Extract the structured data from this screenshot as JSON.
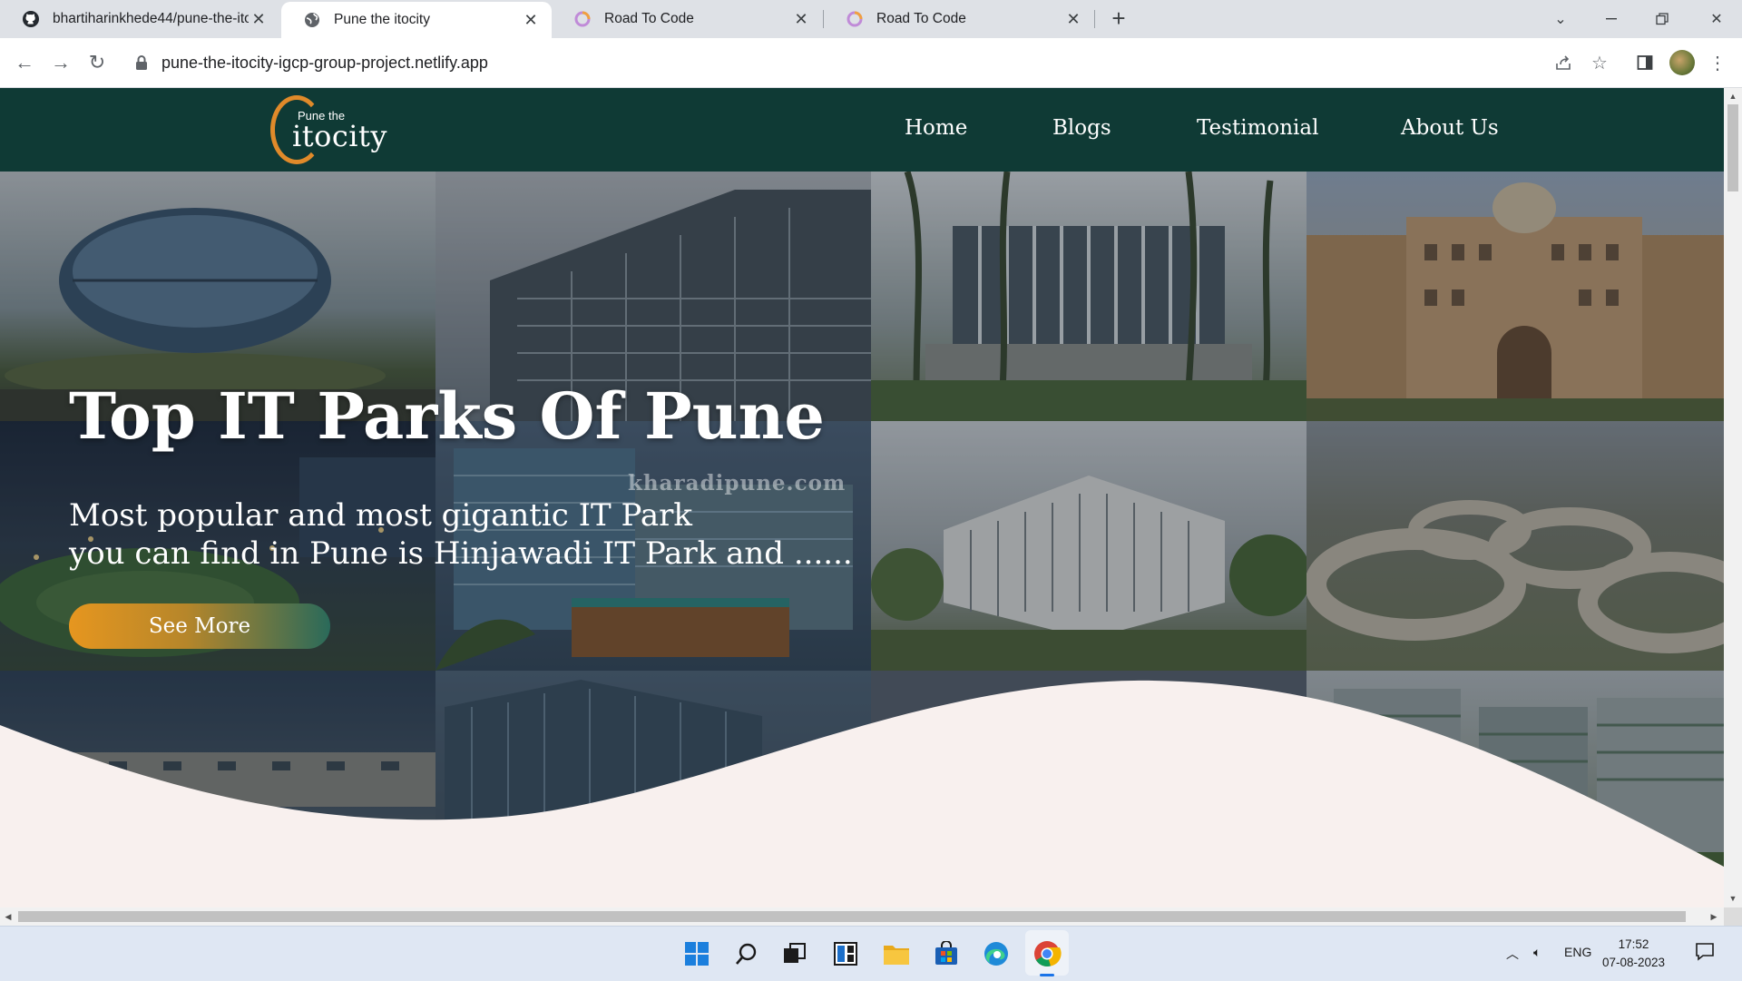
{
  "browser": {
    "tabs": [
      {
        "title": "bhartiharinkhede44/pune-the-ito",
        "icon": "github-icon",
        "active": false
      },
      {
        "title": "Pune the itocity",
        "icon": "globe-icon",
        "active": true
      },
      {
        "title": "Road To Code",
        "icon": "road-to-code-icon",
        "active": false
      },
      {
        "title": "Road To Code",
        "icon": "road-to-code-icon",
        "active": false
      }
    ],
    "url": "pune-the-itocity-igcp-group-project.netlify.app"
  },
  "site": {
    "logo": {
      "small": "Pune the",
      "big": "itocity"
    },
    "nav": [
      "Home",
      "Blogs",
      "Testimonial",
      "About Us"
    ],
    "hero": {
      "title": "Top IT Parks Of Pune",
      "line1": "Most popular and most gigantic IT Park",
      "line2": "you can find in Pune is Hinjawadi IT Park and ......",
      "button": "See More",
      "watermark": "kharadipune.com"
    },
    "colors": {
      "header": "#0f3a35",
      "accent": "#e6961f",
      "wave": "#f8f0ee"
    }
  },
  "taskbar": {
    "language": "ENG",
    "time": "17:52",
    "date": "07-08-2023"
  }
}
